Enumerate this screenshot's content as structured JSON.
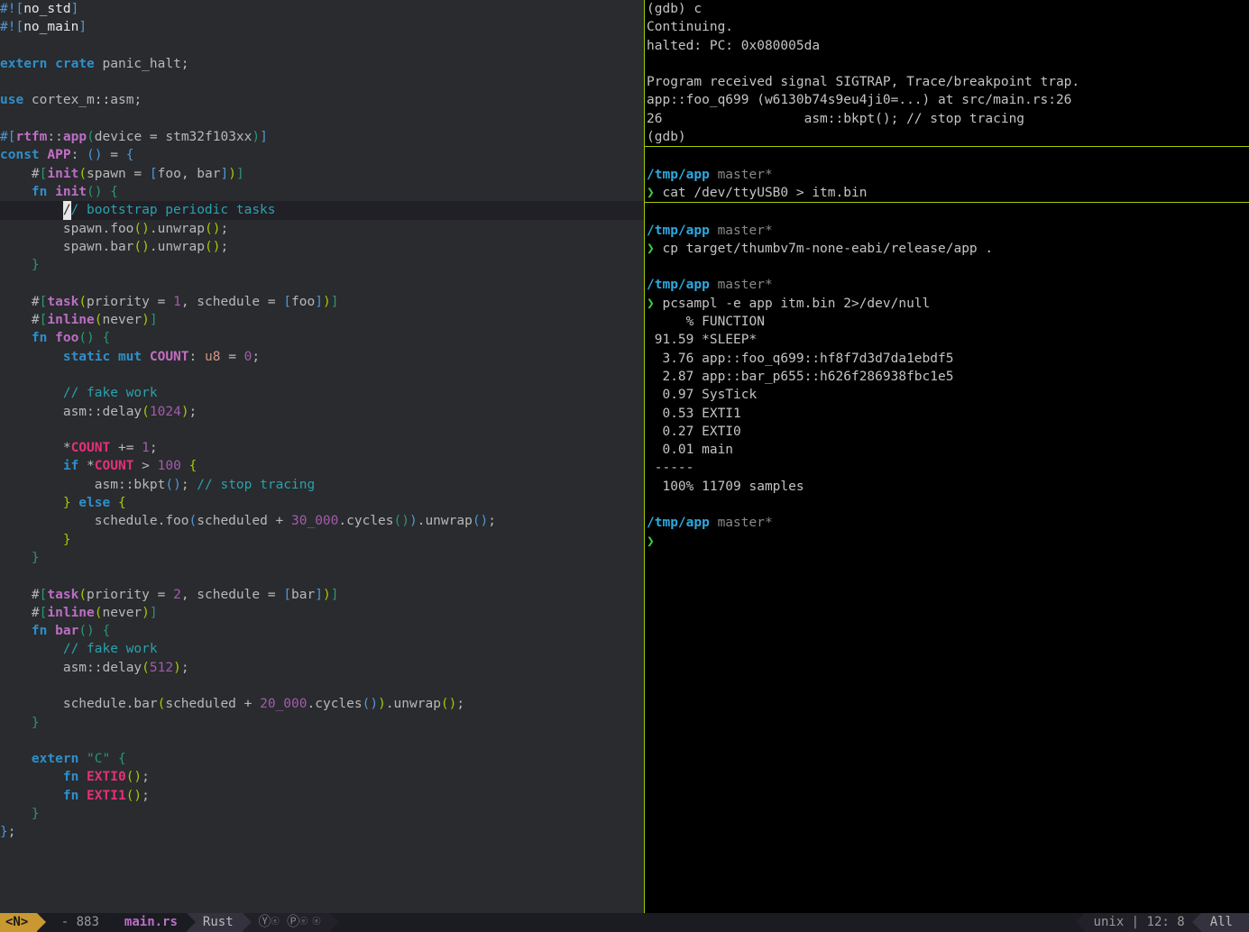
{
  "editor": {
    "lines": {
      "l1a": "#!",
      "l1b": "[",
      "l1c": "no_std",
      "l1d": "]",
      "l2a": "#!",
      "l2b": "[",
      "l2c": "no_main",
      "l2d": "]",
      "l4a": "extern",
      "l4b": "crate",
      "l4c": " panic_halt;",
      "l6a": "use",
      "l6b": " cortex_m",
      "l6c": "::",
      "l6d": "asm;",
      "l8a": "#",
      "l8b": "[",
      "l8c": "rtfm",
      "l8d": "::",
      "l8e": "app",
      "l8f": "(",
      "l8g": "device = stm32f103xx",
      "l8h": ")",
      "l8i": "]",
      "l9a": "const",
      "l9b": " APP",
      "l9c": ": ",
      "l9d": "()",
      "l9e": " = ",
      "l9f": "{",
      "l10a": "    #",
      "l10b": "[",
      "l10c": "init",
      "l10d": "(",
      "l10e": "spawn = ",
      "l10f": "[",
      "l10g": "foo, bar",
      "l10h": "]",
      "l10i": ")",
      "l10j": "]",
      "l11a": "    fn",
      "l11b": " init",
      "l11c": "()",
      "l11d": " {",
      "l12a": "        ",
      "l12b": "/",
      "l12c": "/ bootstrap periodic tasks",
      "l13": "        spawn.foo",
      "l13b": "()",
      "l13c": ".unwrap",
      "l13d": "()",
      "l13e": ";",
      "l14": "        spawn.bar",
      "l14b": "()",
      "l14c": ".unwrap",
      "l14d": "()",
      "l14e": ";",
      "l15": "    }",
      "l17a": "    #",
      "l17b": "[",
      "l17c": "task",
      "l17d": "(",
      "l17e": "priority = ",
      "l17f": "1",
      "l17g": ", schedule = ",
      "l17h": "[",
      "l17i": "foo",
      "l17j": "]",
      "l17k": ")",
      "l17l": "]",
      "l18a": "    #",
      "l18b": "[",
      "l18c": "inline",
      "l18d": "(",
      "l18e": "never",
      "l18f": ")",
      "l18g": "]",
      "l19a": "    fn",
      "l19b": " foo",
      "l19c": "()",
      "l19d": " {",
      "l20a": "        static",
      "l20b": " mut",
      "l20c": " COUNT",
      "l20d": ": ",
      "l20e": "u8",
      "l20f": " = ",
      "l20g": "0",
      "l20h": ";",
      "l22": "        // fake work",
      "l23a": "        asm",
      "l23b": "::",
      "l23c": "delay",
      "l23d": "(",
      "l23e": "1024",
      "l23f": ")",
      "l23g": ";",
      "l25a": "        *",
      "l25b": "COUNT",
      "l25c": " += ",
      "l25d": "1",
      "l25e": ";",
      "l26a": "        if",
      "l26b": " *",
      "l26c": "COUNT",
      "l26d": " > ",
      "l26e": "100",
      "l26f": " {",
      "l27a": "            asm",
      "l27b": "::",
      "l27c": "bkpt",
      "l27d": "()",
      "l27e": "; ",
      "l27f": "// stop tracing",
      "l28a": "        }",
      "l28b": " else",
      "l28c": " {",
      "l29a": "            schedule.foo",
      "l29b": "(",
      "l29c": "scheduled + ",
      "l29d": "30_000",
      "l29e": ".cycles",
      "l29f": "()",
      "l29g": ")",
      "l29h": ".unwrap",
      "l29i": "()",
      "l29j": ";",
      "l30": "        }",
      "l31": "    }",
      "l33a": "    #",
      "l33b": "[",
      "l33c": "task",
      "l33d": "(",
      "l33e": "priority = ",
      "l33f": "2",
      "l33g": ", schedule = ",
      "l33h": "[",
      "l33i": "bar",
      "l33j": "]",
      "l33k": ")",
      "l33l": "]",
      "l34a": "    #",
      "l34b": "[",
      "l34c": "inline",
      "l34d": "(",
      "l34e": "never",
      "l34f": ")",
      "l34g": "]",
      "l35a": "    fn",
      "l35b": " bar",
      "l35c": "()",
      "l35d": " {",
      "l36": "        // fake work",
      "l37a": "        asm",
      "l37b": "::",
      "l37c": "delay",
      "l37d": "(",
      "l37e": "512",
      "l37f": ")",
      "l37g": ";",
      "l39a": "        schedule.bar",
      "l39b": "(",
      "l39c": "scheduled + ",
      "l39d": "20_000",
      "l39e": ".cycles",
      "l39f": "()",
      "l39g": ")",
      "l39h": ".unwrap",
      "l39i": "()",
      "l39j": ";",
      "l40": "    }",
      "l42a": "    extern",
      "l42b": " \"C\"",
      "l42c": " {",
      "l43a": "        fn",
      "l43b": " EXTI0",
      "l43c": "()",
      "l43d": ";",
      "l44a": "        fn",
      "l44b": " EXTI1",
      "l44c": "()",
      "l44d": ";",
      "l45": "    }",
      "l46a": "}",
      "l46b": ";"
    }
  },
  "gdb": {
    "l1": "(gdb) c",
    "l2": "Continuing.",
    "l3": "halted: PC: 0x080005da",
    "l5": "Program received signal SIGTRAP, Trace/breakpoint trap.",
    "l6": "app::foo_q699 (w6130b74s9eu4ji0=...) at src/main.rs:26",
    "l7": "26                  asm::bkpt(); // stop tracing",
    "l8": "(gdb) "
  },
  "term1": {
    "path": "/tmp/app",
    "branch": " master*",
    "cmd": " cat /dev/ttyUSB0 > itm.bin"
  },
  "term2": {
    "path1": "/tmp/app",
    "branch1": " master*",
    "cmd1": " cp target/thumbv7m-none-eabi/release/app .",
    "path2": "/tmp/app",
    "branch2": " master*",
    "cmd2": " pcsampl -e app itm.bin 2>/dev/null",
    "out1": "     % FUNCTION",
    "out2": " 91.59 *SLEEP*",
    "out3": "  3.76 app::foo_q699::hf8f7d3d7da1ebdf5",
    "out4": "  2.87 app::bar_p655::h626f286938fbc1e5",
    "out5": "  0.97 SysTick",
    "out6": "  0.53 EXTI1",
    "out7": "  0.27 EXTI0",
    "out8": "  0.01 main",
    "out9": " -----",
    "out10": "  100% 11709 samples",
    "path3": "/tmp/app",
    "branch3": " master*"
  },
  "modeline": {
    "mode": "<N>",
    "modified": "-",
    "count": "883",
    "file": "main.rs",
    "lang": "Rust",
    "minor1": "Ⓨ",
    "minor1s": "ⓔ",
    "minor2": "Ⓟ",
    "minor2s": "ⓔ ⓔ",
    "encoding": "unix",
    "pos": "12: 8",
    "scroll": "All"
  }
}
